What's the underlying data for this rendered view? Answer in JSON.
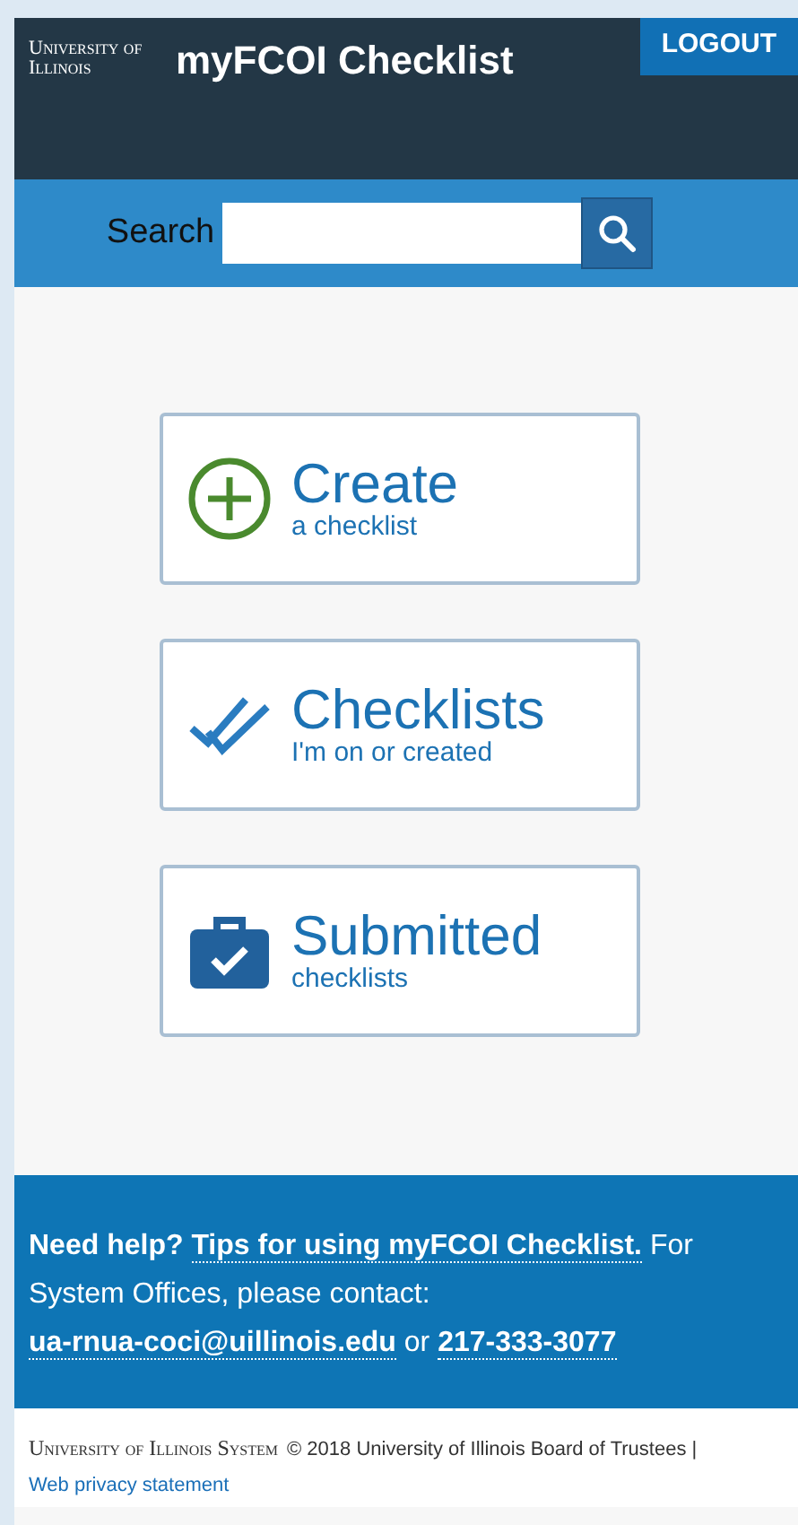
{
  "header": {
    "logo": "University of Illinois",
    "title": "myFCOI Checklist",
    "logout": "LOGOUT"
  },
  "search": {
    "label": "Search"
  },
  "actions": [
    {
      "kind": "create",
      "title": "Create",
      "subtitle": "a checklist"
    },
    {
      "kind": "checklists",
      "title": "Checklists",
      "subtitle": "I'm on or created"
    },
    {
      "kind": "submitted",
      "title": "Submitted",
      "subtitle": "checklists"
    }
  ],
  "help": {
    "lead": "Need help?",
    "tips_link": "Tips for using myFCOI Checklist.",
    "middle": "For System Offices, please contact:",
    "email": "ua-rnua-coci@uillinois.edu",
    "joiner": "or",
    "phone": "217-333-3077"
  },
  "footer": {
    "logo": "University of Illinois System",
    "copyright": "© 2018 University of Illinois Board of Trustees |",
    "privacy_link": "Web privacy statement"
  }
}
